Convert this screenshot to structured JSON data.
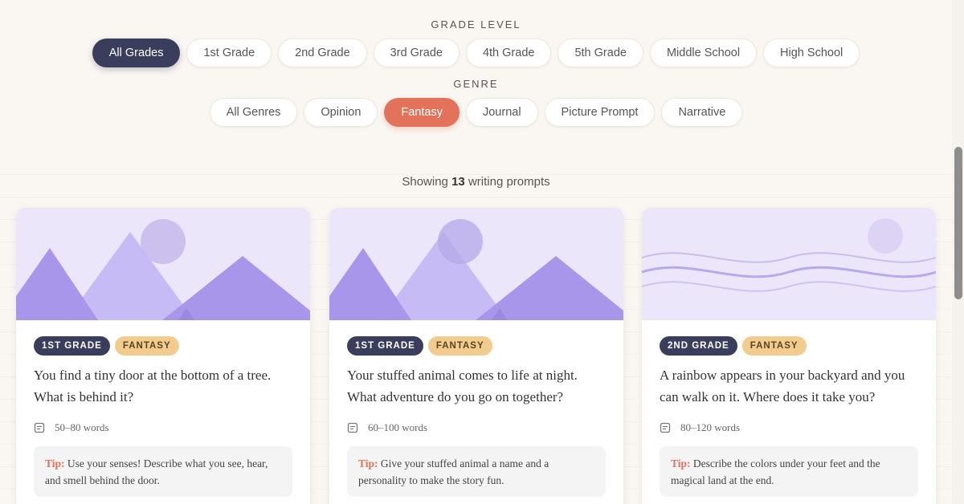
{
  "filters": {
    "grade_label": "GRADE LEVEL",
    "grades": [
      "All Grades",
      "1st Grade",
      "2nd Grade",
      "3rd Grade",
      "4th Grade",
      "5th Grade",
      "Middle School",
      "High School"
    ],
    "active_grade": "All Grades",
    "genre_label": "GENRE",
    "genres": [
      "All Genres",
      "Opinion",
      "Fantasy",
      "Journal",
      "Picture Prompt",
      "Narrative"
    ],
    "active_genre": "Fantasy"
  },
  "results": {
    "prefix": "Showing",
    "count": "13",
    "suffix": "writing prompts"
  },
  "cards": [
    {
      "grade": "1ST GRADE",
      "genre": "FANTASY",
      "prompt": "You find a tiny door at the bottom of a tree. What is behind it?",
      "words": "50–80 words",
      "tip_label": "Tip:",
      "tip": "Use your senses! Describe what you see, hear, and smell behind the door.",
      "art": "mountains"
    },
    {
      "grade": "1ST GRADE",
      "genre": "FANTASY",
      "prompt": "Your stuffed animal comes to life at night. What adventure do you go on together?",
      "words": "60–100 words",
      "tip_label": "Tip:",
      "tip": "Give your stuffed animal a name and a personality to make the story fun.",
      "art": "mountains"
    },
    {
      "grade": "2ND GRADE",
      "genre": "FANTASY",
      "prompt": "A rainbow appears in your backyard and you can walk on it. Where does it take you?",
      "words": "80–120 words",
      "tip_label": "Tip:",
      "tip": "Describe the colors under your feet and the magical land at the end.",
      "art": "waves"
    }
  ],
  "colors": {
    "active_grade": "#3b3d5c",
    "active_genre": "#e2735a",
    "badge_genre": "#f2cc8f",
    "art_bg": "#ece6fa"
  }
}
